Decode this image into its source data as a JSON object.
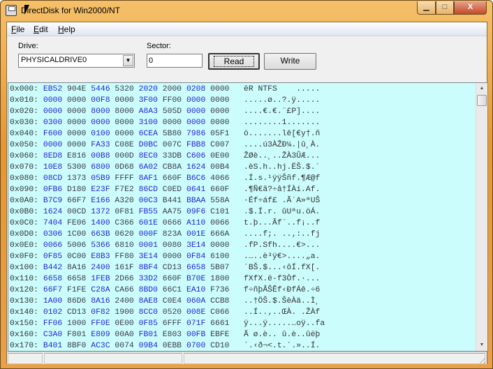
{
  "window": {
    "title": "DirectDisk for Win2000/NT",
    "minimize": "▁",
    "maximize": "□",
    "close": "X"
  },
  "menu": [
    {
      "label": "File",
      "key": "F",
      "rest": "ile"
    },
    {
      "label": "Edit",
      "key": "E",
      "rest": "dit"
    },
    {
      "label": "Help",
      "key": "H",
      "rest": "elp"
    }
  ],
  "toolbar": {
    "drive_label": "Drive:",
    "drive_value": "PHYSICALDRIVE0",
    "sector_label": "Sector:",
    "sector_value": "0",
    "read_label": "Read",
    "write_label": "Write"
  },
  "hex_rows": [
    {
      "addr": "0x000:",
      "hex": [
        "EB52",
        "904E",
        "5446",
        "5320",
        "2020",
        "2000",
        "0208",
        "0000"
      ],
      "ascii": "ëR NTFS    ....."
    },
    {
      "addr": "0x010:",
      "hex": [
        "0000",
        "0000",
        "00F8",
        "0000",
        "3F00",
        "FF00",
        "0000",
        "0000"
      ],
      "ascii": ".....ø..?.ÿ....."
    },
    {
      "addr": "0x020:",
      "hex": [
        "0000",
        "0000",
        "8000",
        "8000",
        "A8A3",
        "505D",
        "0000",
        "0000"
      ],
      "ascii": "....€.€.¨£P]...."
    },
    {
      "addr": "0x030:",
      "hex": [
        "0300",
        "0000",
        "0000",
        "0000",
        "3100",
        "0000",
        "0000",
        "0000"
      ],
      "ascii": "........1......."
    },
    {
      "addr": "0x040:",
      "hex": [
        "F600",
        "0000",
        "0100",
        "0000",
        "6CEA",
        "5B80",
        "7986",
        "05F1"
      ],
      "ascii": "ö.......lê[€y†.ñ"
    },
    {
      "addr": "0x050:",
      "hex": [
        "0000",
        "0000",
        "FA33",
        "C08E",
        "D0BC",
        "007C",
        "FBB8",
        "C007"
      ],
      "ascii": "....ú3ÀŽÐ¼.|û¸À."
    },
    {
      "addr": "0x060:",
      "hex": [
        "8ED8",
        "E816",
        "00B8",
        "000D",
        "8EC0",
        "33DB",
        "C606",
        "0E00"
      ],
      "ascii": "ŽØè..¸..ŽÀ3ÛÆ..."
    },
    {
      "addr": "0x070:",
      "hex": [
        "10E8",
        "5300",
        "6800",
        "0D68",
        "6A02",
        "CB8A",
        "1624",
        "00B4"
      ],
      "ascii": ".èS.h..hj.ËŠ.$.´"
    },
    {
      "addr": "0x080:",
      "hex": [
        "08CD",
        "1373",
        "05B9",
        "FFFF",
        "8AF1",
        "660F",
        "B6C6",
        "4066"
      ],
      "ascii": ".Í.s.¹ÿÿŠñf.¶Æ@f"
    },
    {
      "addr": "0x090:",
      "hex": [
        "0FB6",
        "D180",
        "E23F",
        "F7E2",
        "86CD",
        "C0ED",
        "0641",
        "660F"
      ],
      "ascii": ".¶Ñ€â?÷â†ÍÀí.Af."
    },
    {
      "addr": "0x0A0:",
      "hex": [
        "B7C9",
        "66F7",
        "E166",
        "A320",
        "00C3",
        "B441",
        "BBAA",
        "558A"
      ],
      "ascii": "·Éf÷áf£ .Ã´A»ªUŠ"
    },
    {
      "addr": "0x0B0:",
      "hex": [
        "1624",
        "00CD",
        "1372",
        "0F81",
        "FB55",
        "AA75",
        "09F6",
        "C101"
      ],
      "ascii": ".$.Í.r. ûUªu.öÁ."
    },
    {
      "addr": "0x0C0:",
      "hex": [
        "7404",
        "FE06",
        "1400",
        "C366",
        "601E",
        "0666",
        "A110",
        "0066"
      ],
      "ascii": "t.þ...Ãf`..f¡..f"
    },
    {
      "addr": "0x0D0:",
      "hex": [
        "0306",
        "1C00",
        "663B",
        "0620",
        "000F",
        "823A",
        "001E",
        "666A"
      ],
      "ascii": "....f;. ..‚:..fj"
    },
    {
      "addr": "0x0E0:",
      "hex": [
        "0066",
        "5006",
        "5366",
        "6810",
        "0001",
        "0080",
        "3E14",
        "0000"
      ],
      "ascii": ".fP.Sfh....€>..."
    },
    {
      "addr": "0x0F0:",
      "hex": [
        "0F85",
        "0C00",
        "E8B3",
        "FF80",
        "3E14",
        "0000",
        "0F84",
        "6100"
      ],
      "ascii": ".…..è³ÿ€>....„a."
    },
    {
      "addr": "0x100:",
      "hex": [
        "B442",
        "8A16",
        "2400",
        "161F",
        "8BF4",
        "CD13",
        "6658",
        "5B07"
      ],
      "ascii": "´BŠ.$...‹ôÍ.fX[."
    },
    {
      "addr": "0x110:",
      "hex": [
        "6658",
        "6658",
        "1FEB",
        "2D66",
        "33D2",
        "660F",
        "B70E",
        "1800"
      ],
      "ascii": "fXfX.ë-f3Òf.·..."
    },
    {
      "addr": "0x120:",
      "hex": [
        "66F7",
        "F1FE",
        "C28A",
        "CA66",
        "8BD0",
        "66C1",
        "EA10",
        "F736"
      ],
      "ascii": "f÷ñþÂŠÊf‹ÐfÁê.÷6"
    },
    {
      "addr": "0x130:",
      "hex": [
        "1A00",
        "86D6",
        "8A16",
        "2400",
        "8AE8",
        "C0E4",
        "060A",
        "CCB8"
      ],
      "ascii": "..†ÖŠ.$.ŠèÀä..Ì¸"
    },
    {
      "addr": "0x140:",
      "hex": [
        "0102",
        "CD13",
        "0F82",
        "1900",
        "8CC0",
        "0520",
        "008E",
        "C066"
      ],
      "ascii": "..Í..‚..ŒÀ. .ŽÀf"
    },
    {
      "addr": "0x150:",
      "hex": [
        "FF06",
        "1000",
        "FF0E",
        "0E00",
        "0F85",
        "6FFF",
        "071F",
        "6661"
      ],
      "ascii": "ÿ...ÿ.....…oÿ..fa"
    },
    {
      "addr": "0x160:",
      "hex": [
        "C3A0",
        "F801",
        "E809",
        "00A0",
        "FB01",
        "E803",
        "00FB",
        "EBFE"
      ],
      "ascii": "Ã ø.è.. û.è..ûëþ"
    },
    {
      "addr": "0x170:",
      "hex": [
        "B401",
        "8BF0",
        "AC3C",
        "0074",
        "09B4",
        "0EBB",
        "0700",
        "CD10"
      ],
      "ascii": "´.‹ð¬<.t.´.»..Í."
    }
  ],
  "statusbar": {
    "panes": [
      "",
      "",
      ""
    ]
  }
}
